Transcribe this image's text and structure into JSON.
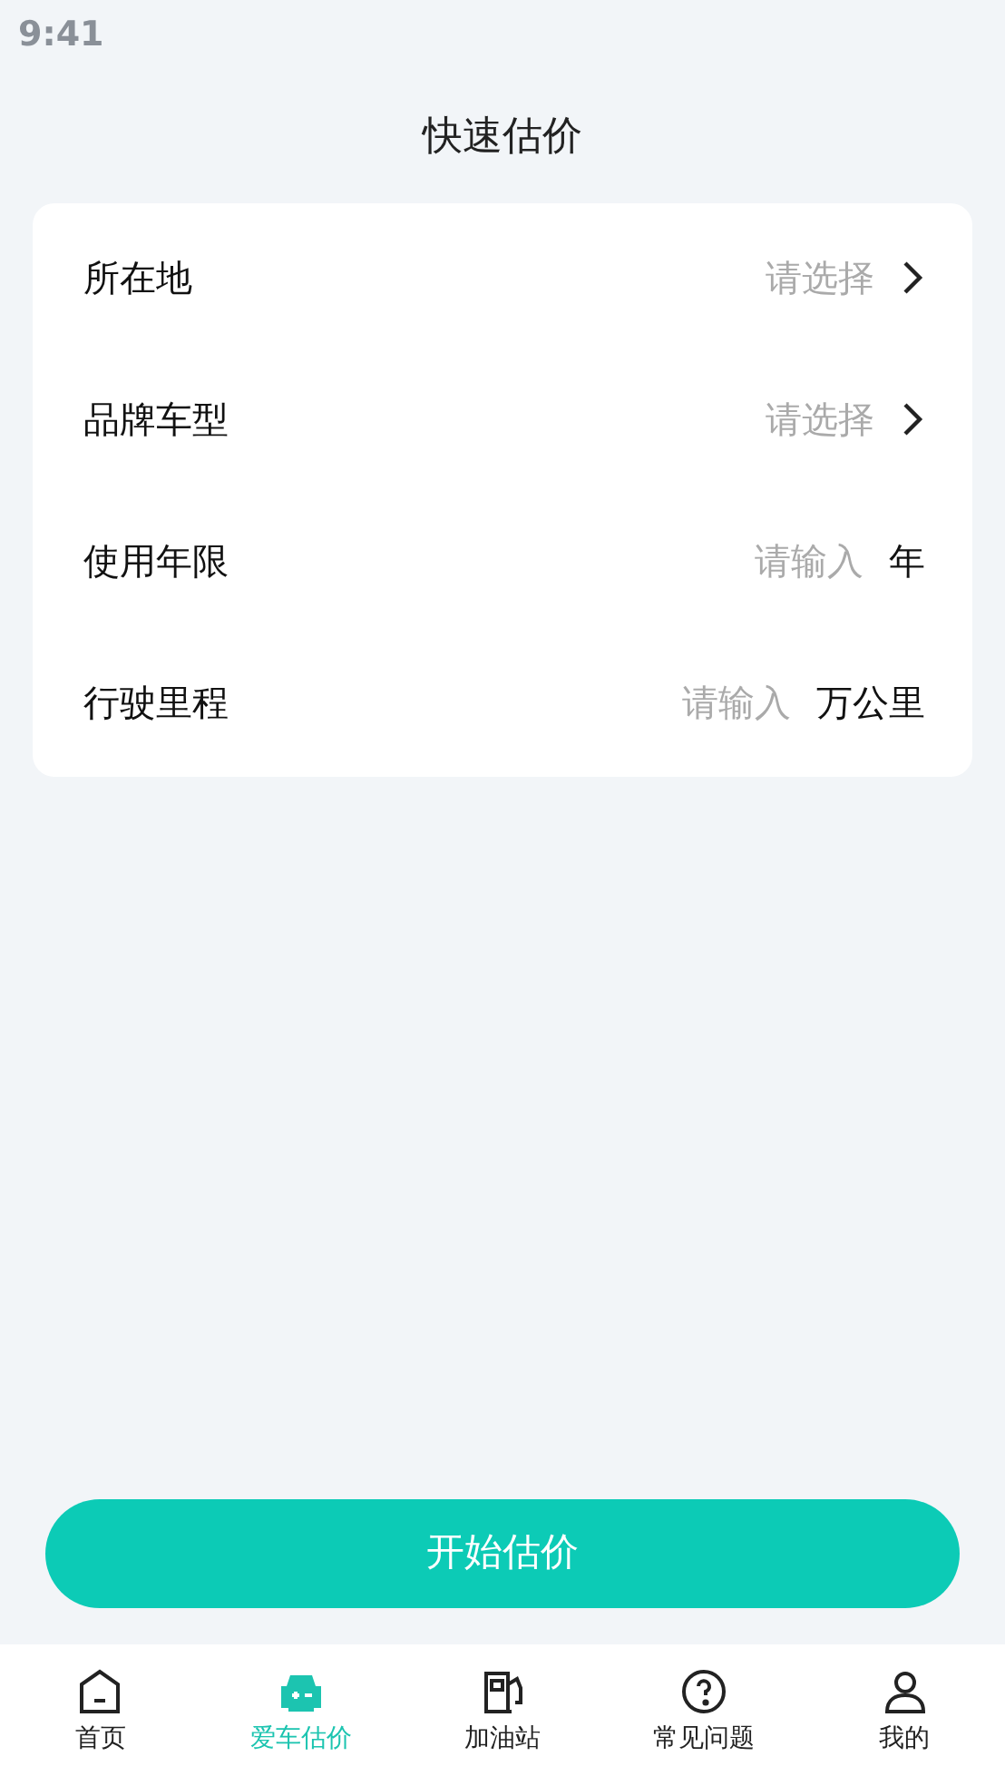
{
  "status_bar": {
    "time": "9:41"
  },
  "title": "快速估价",
  "form": [
    {
      "kind": "select",
      "label": "所在地",
      "placeholder": "请选择"
    },
    {
      "kind": "select",
      "label": "品牌车型",
      "placeholder": "请选择"
    },
    {
      "kind": "input",
      "label": "使用年限",
      "placeholder": "请输入",
      "unit": "年"
    },
    {
      "kind": "input",
      "label": "行驶里程",
      "placeholder": "请输入",
      "unit": "万公里"
    }
  ],
  "submit_button": "开始估价",
  "tab_bar": [
    {
      "kind": "home",
      "label": "首页",
      "selected": false
    },
    {
      "kind": "car",
      "label": "爱车估价",
      "selected": true
    },
    {
      "kind": "fuel",
      "label": "加油站",
      "selected": false
    },
    {
      "kind": "help",
      "label": "常见问题",
      "selected": false
    },
    {
      "kind": "user",
      "label": "我的",
      "selected": false
    }
  ]
}
